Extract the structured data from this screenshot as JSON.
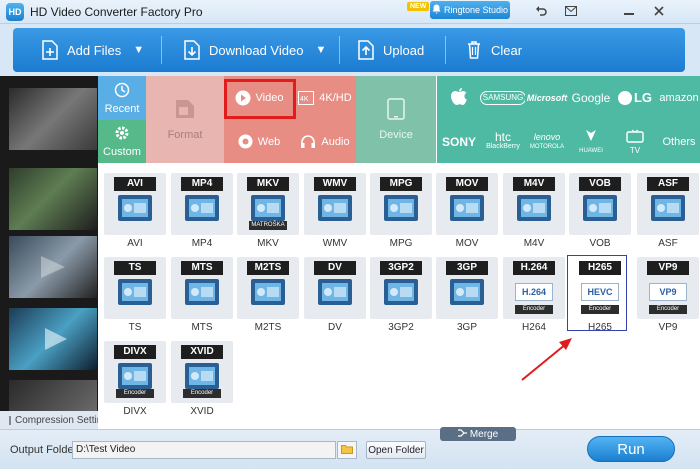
{
  "window": {
    "title": "HD Video Converter Factory Pro",
    "logo_text": "HD",
    "new_badge": "NEW",
    "ringtone_label": "Ringtone Studio"
  },
  "toolbar": {
    "add_files": "Add Files",
    "download_video": "Download Video",
    "upload": "Upload",
    "clear": "Clear"
  },
  "categories": {
    "recent": "Recent",
    "custom": "Custom",
    "format": "Format",
    "video": "Video",
    "khd": "4K/HD",
    "web": "Web",
    "audio": "Audio",
    "device": "Device"
  },
  "brands": {
    "samsung": "SAMSUNG",
    "microsoft": "Microsoft",
    "google": "Google",
    "lg": "LG",
    "amazon": "amazon",
    "sony": "SONY",
    "htc": "htc",
    "htc_sub": "BlackBerry",
    "lenovo": "lenovo",
    "motorola": "MOTOROLA",
    "huawei": "HUAWEI",
    "tv": "TV",
    "others": "Others"
  },
  "formats": [
    {
      "tag": "AVI",
      "label": "AVI"
    },
    {
      "tag": "MP4",
      "label": "MP4"
    },
    {
      "tag": "MKV",
      "label": "MKV",
      "sub": "MATROŠKA"
    },
    {
      "tag": "WMV",
      "label": "WMV"
    },
    {
      "tag": "MPG",
      "label": "MPG"
    },
    {
      "tag": "MOV",
      "label": "MOV"
    },
    {
      "tag": "M4V",
      "label": "M4V"
    },
    {
      "tag": "VOB",
      "label": "VOB"
    },
    {
      "tag": "ASF",
      "label": "ASF"
    },
    {
      "tag": "TS",
      "label": "TS"
    },
    {
      "tag": "MTS",
      "label": "MTS"
    },
    {
      "tag": "M2TS",
      "label": "M2TS"
    },
    {
      "tag": "DV",
      "label": "DV"
    },
    {
      "tag": "3GP2",
      "label": "3GP2"
    },
    {
      "tag": "3GP",
      "label": "3GP"
    },
    {
      "tag": "H.264",
      "label": "H264",
      "inner": "H.264",
      "sub": "Encoder"
    },
    {
      "tag": "H265",
      "label": "H265",
      "inner": "HEVC",
      "sub": "Encoder",
      "selected": true
    },
    {
      "tag": "VP9",
      "label": "VP9",
      "inner": "VP9",
      "sub": "Encoder"
    },
    {
      "tag": "DIVX",
      "label": "DIVX",
      "sub": "Encoder"
    },
    {
      "tag": "XVID",
      "label": "XVID",
      "sub": "Encoder"
    }
  ],
  "compression": "Compression Settings",
  "bottom": {
    "output_label": "Output Folder:",
    "output_value": "D:\\Test Video",
    "open_folder": "Open Folder",
    "merge": "Merge",
    "run": "Run"
  },
  "colors": {
    "toolbar": "#2a8ce0",
    "video_category": "#e78d84",
    "device_brands": "#4fbaa3",
    "selection_highlight": "#e01c1c"
  }
}
